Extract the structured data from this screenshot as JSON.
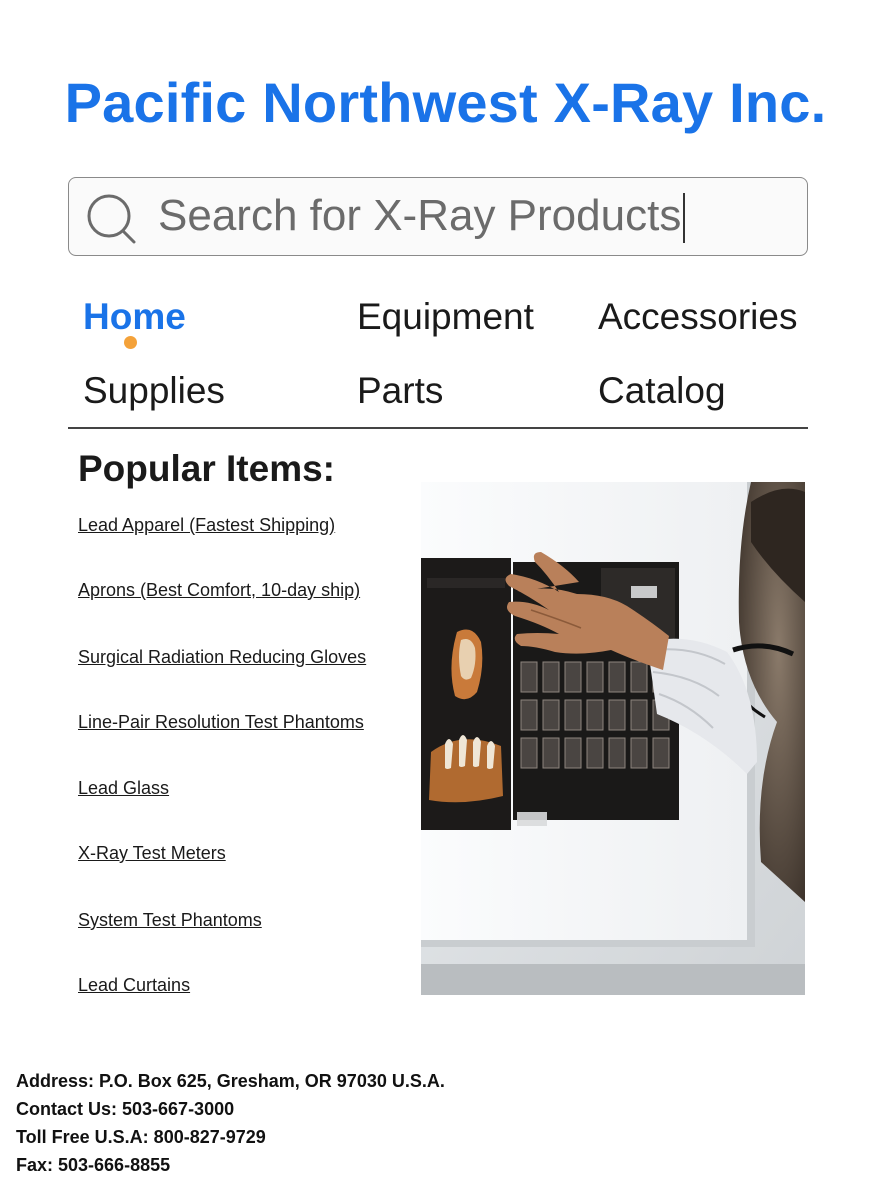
{
  "header": {
    "title": "Pacific Northwest X-Ray Inc."
  },
  "search": {
    "placeholder": "Search for X-Ray Products",
    "icon": "search-icon"
  },
  "nav": {
    "items": [
      {
        "label": "Home",
        "active": true
      },
      {
        "label": "Equipment"
      },
      {
        "label": "Accessories"
      },
      {
        "label": "Supplies"
      },
      {
        "label": "Parts"
      },
      {
        "label": "Catalog"
      }
    ]
  },
  "popular": {
    "heading": "Popular Items:",
    "items": [
      "Lead Apparel (Fastest Shipping)",
      "Aprons (Best Comfort, 10-day ship)",
      "Surgical Radiation Reducing Gloves",
      "Line-Pair Resolution Test Phantoms",
      "Lead Glass",
      "X-Ray Test Meters",
      "System Test Phantoms",
      "Lead Curtains"
    ]
  },
  "footer": {
    "address": "Address: P.O. Box 625, Gresham, OR 97030 U.S.A.",
    "contact": "Contact Us: 503-667-3000",
    "tollfree": "Toll Free U.S.A: 800-827-9729",
    "fax": "Fax: 503-666-8855"
  },
  "colors": {
    "brand": "#1a73e8",
    "accent_dot": "#f4a23a"
  }
}
